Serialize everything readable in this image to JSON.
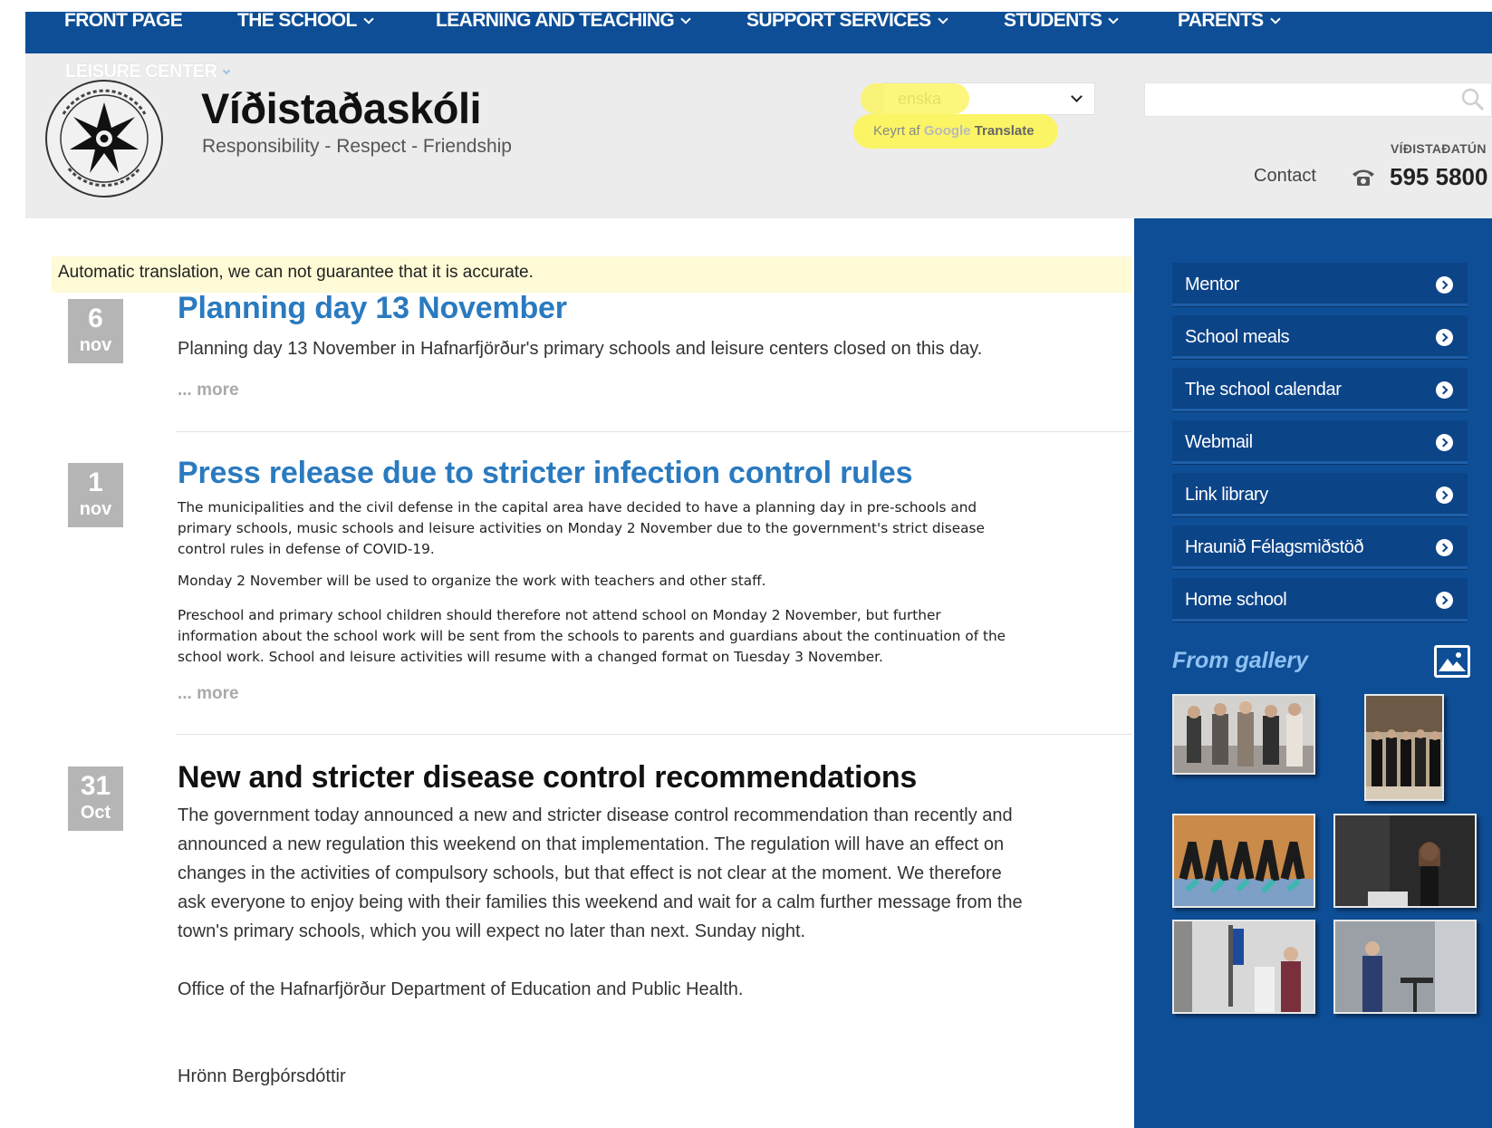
{
  "nav": {
    "items": [
      {
        "label": "FRONT PAGE",
        "dropdown": false
      },
      {
        "label": "THE SCHOOL",
        "dropdown": true
      },
      {
        "label": "LEARNING AND TEACHING",
        "dropdown": true
      },
      {
        "label": "SUPPORT SERVICES",
        "dropdown": true
      },
      {
        "label": "STUDENTS",
        "dropdown": true
      },
      {
        "label": "PARENTS",
        "dropdown": true
      }
    ],
    "leisure_label": "LEISURE CENTER"
  },
  "header": {
    "school_name": "Víðistaðaskóli",
    "motto": "Responsibility - Respect - Friendship",
    "language_select": "enska",
    "translate_powered": "Keyrt af",
    "translate_brand": "Google",
    "translate_label": "Translate",
    "search_value": "",
    "address": "VÍÐISTAÐATÚN",
    "contact_label": "Contact",
    "phone": "595 5800"
  },
  "notice": "Automatic translation, we can not guarantee that it is accurate.",
  "news": [
    {
      "day": "6",
      "month": "nov",
      "title": "Planning day 13 November",
      "paragraphs": [
        "Planning day 13 November in Hafnarfjörður's primary schools and leisure centers closed on this day."
      ],
      "more": "... more"
    },
    {
      "day": "1",
      "month": "nov",
      "title": "Press release due to stricter infection control rules",
      "paragraphs": [
        "The municipalities and the civil defense in the capital area have decided to have a planning day in pre-schools and primary schools, music schools and leisure activities on Monday 2 November due to the government's strict disease control rules in defense of COVID-19.",
        "Monday 2 November will be used to organize the work with teachers and other staff.",
        "Preschool and primary school children should therefore not attend school on Monday 2 November, but further information about the school work will be sent from the schools to parents and guardians about the continuation of the school work. School and leisure activities will resume with a changed format on Tuesday 3 November."
      ],
      "more": "... more"
    },
    {
      "day": "31",
      "month": "Oct",
      "title": "New and stricter disease control recommendations",
      "paragraphs": [
        "The government today announced a new and stricter disease control recommendation than recently and announced a new regulation this weekend on that implementation. The regulation will have an effect on changes in the activities of compulsory schools, but that effect is not clear at the moment. We therefore ask everyone to enjoy being with their families this weekend and wait for a calm further message from the town's primary schools, which you will expect no later than next. Sunday night.",
        "Office of the Hafnarfjörður Department of Education and Public Health.",
        "Hrönn Bergþórsdóttir"
      ]
    }
  ],
  "sidebar": {
    "links": [
      "Mentor",
      "School meals",
      "The school calendar",
      "Webmail",
      "Link library",
      "Hraunið Félagsmiðstöð",
      "Home school"
    ],
    "gallery_title": "From gallery"
  },
  "colors": {
    "brand_blue": "#0e4e96",
    "link_blue": "#2a7abf",
    "highlight_yellow": "#fbf565",
    "notice_bg": "#fefbd6",
    "gallery_title": "#8fc1f1"
  }
}
